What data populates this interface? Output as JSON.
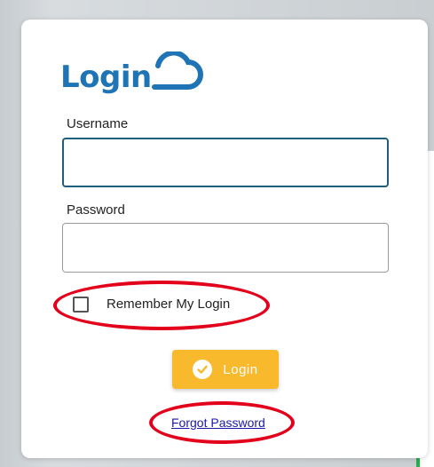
{
  "brand": {
    "title": "Login",
    "logo_icon": "cloud-icon",
    "color": "#1f74b5"
  },
  "form": {
    "username_label": "Username",
    "username_value": "",
    "password_label": "Password",
    "password_value": "",
    "remember_label": "Remember My Login",
    "remember_checked": false,
    "login_button_label": "Login",
    "login_button_icon": "check-circle-icon",
    "login_button_color": "#f9b92d",
    "forgot_password_label": "Forgot Password"
  },
  "annotations": {
    "highlight_color": "#e3001b"
  }
}
